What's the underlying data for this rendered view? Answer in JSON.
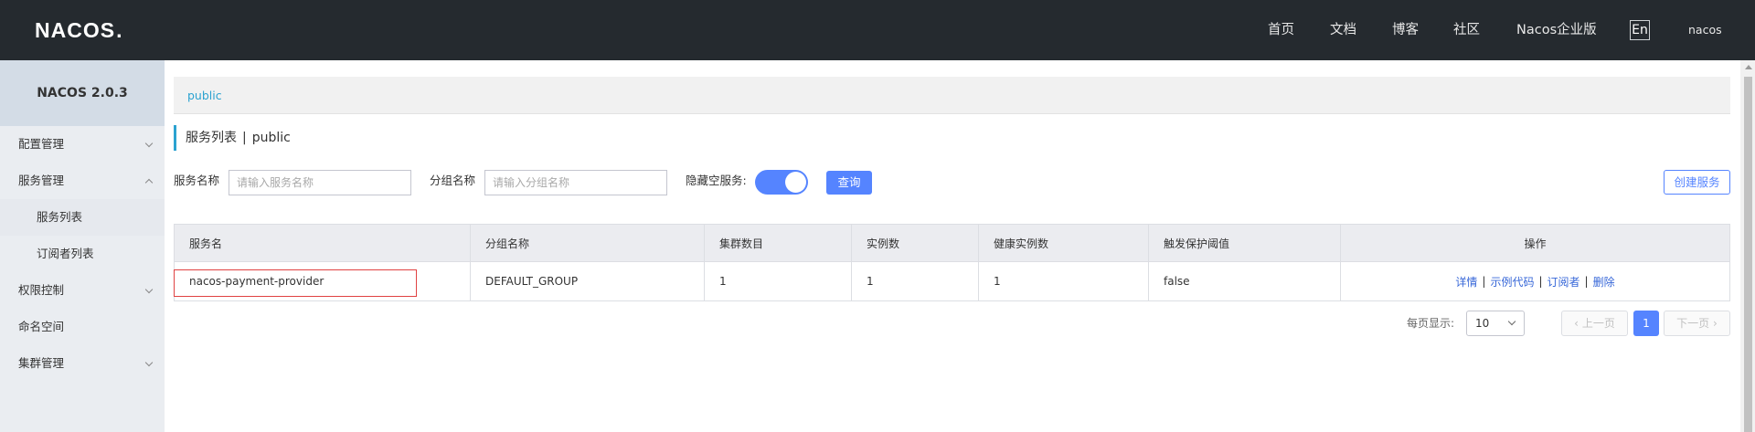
{
  "header": {
    "logo": "NACOS",
    "nav": [
      "首页",
      "文档",
      "博客",
      "社区",
      "Nacos企业版"
    ],
    "lang": "En",
    "user": "nacos"
  },
  "sidebar": {
    "version": "NACOS 2.0.3",
    "items": [
      {
        "label": "配置管理",
        "expanded": false
      },
      {
        "label": "服务管理",
        "expanded": true
      },
      {
        "label": "服务列表",
        "sub": true,
        "active": true
      },
      {
        "label": "订阅者列表",
        "sub": true
      },
      {
        "label": "权限控制",
        "expanded": false
      },
      {
        "label": "命名空间"
      },
      {
        "label": "集群管理",
        "expanded": false
      }
    ]
  },
  "breadcrumb": "public",
  "title": {
    "main": "服务列表",
    "sep": "|",
    "namespace": "public"
  },
  "filters": {
    "service_label": "服务名称",
    "service_placeholder": "请输入服务名称",
    "group_label": "分组名称",
    "group_placeholder": "请输入分组名称",
    "hide_empty_label": "隐藏空服务:",
    "hide_empty_on": true,
    "query_button": "查询",
    "create_button": "创建服务"
  },
  "table": {
    "headers": [
      "服务名",
      "分组名称",
      "集群数目",
      "实例数",
      "健康实例数",
      "触发保护阈值",
      "操作"
    ],
    "rows": [
      {
        "name": "nacos-payment-provider",
        "group": "DEFAULT_GROUP",
        "clusters": "1",
        "instances": "1",
        "healthy": "1",
        "protect": "false"
      }
    ],
    "ops": [
      "详情",
      "示例代码",
      "订阅者",
      "删除"
    ]
  },
  "pagination": {
    "page_size_label": "每页显示:",
    "page_size": "10",
    "prev": "上一页",
    "current": "1",
    "next": "下一页"
  },
  "colors": {
    "accent": "#5584ff",
    "link": "#2ba2d0",
    "header": "#252a2f",
    "highlight": "#e04242"
  }
}
